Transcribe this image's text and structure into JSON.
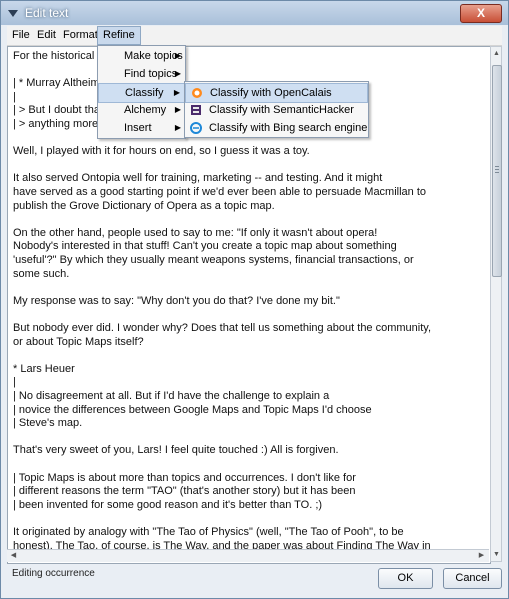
{
  "window": {
    "title": "Edit text",
    "close_label": "X"
  },
  "menubar": [
    "File",
    "Edit",
    "Format",
    "Refine"
  ],
  "refine_menu": [
    "Make topics",
    "Find topics",
    "Classify",
    "Alchemy",
    "Insert"
  ],
  "classify_submenu": [
    {
      "label": "Classify with OpenCalais",
      "icon": "opencalais-icon"
    },
    {
      "label": "Classify with SemanticHacker",
      "icon": "semantichacker-icon"
    },
    {
      "label": "Classify with Bing search engine",
      "icon": "bing-icon"
    }
  ],
  "editor": {
    "lines": [
      "For the historical r",
      "",
      "| * Murray Altheim",
      "|",
      "| > But I doubt that",
      "| > anything more t",
      "",
      "Well, I played with it for hours on end, so I guess it was a toy.",
      "",
      "It also served Ontopia well for training, marketing -- and testing. And it might",
      "have served as a good starting point if we'd ever been able to persuade Macmillan to",
      "publish the Grove Dictionary of Opera as a topic map.",
      "",
      "On the other hand, people used to say to me: \"If only it wasn't about opera!",
      "Nobody's interested in that stuff! Can't you create a topic map about something",
      "'useful'?\" By which they usually meant weapons systems, financial transactions, or",
      "some such.",
      "",
      "My response was to say: \"Why don't you do that? I've done my bit.\"",
      "",
      "But nobody ever did. I wonder why? Does that tell us something about the community,",
      "or about Topic Maps itself?",
      "",
      "* Lars Heuer",
      "|",
      "| No disagreement at all. But if I'd have the challenge to explain a",
      "| novice the differences between Google Maps and Topic Maps I'd choose",
      "| Steve's map.",
      "",
      "That's very sweet of you, Lars! I feel quite touched :) All is forgiven.",
      "",
      "| Topic Maps is about more than topics and occurrences. I don't like for",
      "| different reasons the term \"TAO\" (that's another story) but it has been",
      "| been invented for some good reason and it's better than TO. ;)",
      "",
      "It originated by analogy with \"The Tao of Physics\" (well, \"The Tao of Pooh\", to be",
      "honest). The Tao, of course, is The Way, and the paper was about Finding The Way in"
    ]
  },
  "status": "Editing occurrence",
  "buttons": {
    "ok": "OK",
    "cancel": "Cancel"
  }
}
